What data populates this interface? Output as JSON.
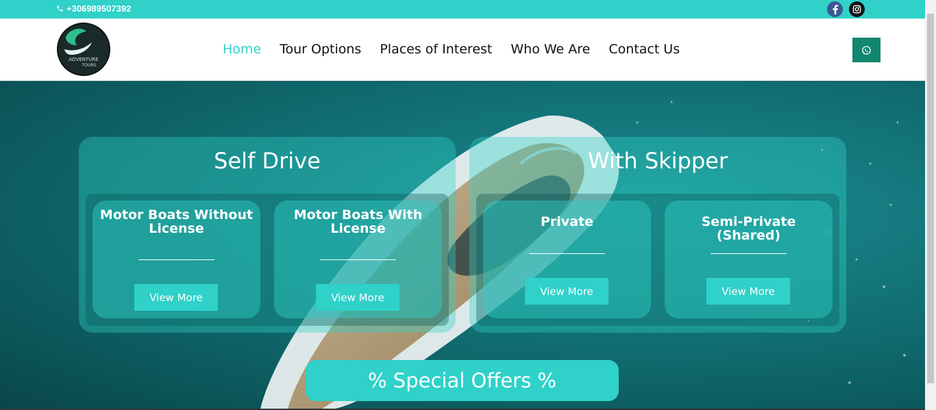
{
  "topbar": {
    "phone": "+306989507392",
    "social": [
      {
        "name": "facebook",
        "icon": "facebook-icon",
        "color": "#3b5998"
      },
      {
        "name": "instagram",
        "icon": "instagram-icon",
        "color": "#111111"
      }
    ]
  },
  "header": {
    "logo_text": "ADVENTURE TOURS",
    "nav": [
      {
        "label": "Home",
        "active": true
      },
      {
        "label": "Tour Options",
        "active": false
      },
      {
        "label": "Places of Interest",
        "active": false
      },
      {
        "label": "Who We Are",
        "active": false
      },
      {
        "label": "Contact Us",
        "active": false
      }
    ],
    "whatsapp_icon": "whatsapp-icon"
  },
  "hero": {
    "panels": [
      {
        "title": "Self Drive",
        "cards": [
          {
            "title": "Motor Boats Without License",
            "button": "View More"
          },
          {
            "title": "Motor Boats With License",
            "button": "View More"
          }
        ]
      },
      {
        "title": "With Skipper",
        "cards": [
          {
            "title": "Private",
            "button": "View More"
          },
          {
            "title": "Semi-Private (Shared)",
            "button": "View More"
          }
        ]
      }
    ],
    "offers_button": "% Special Offers %"
  },
  "colors": {
    "accent": "#2fd1c9",
    "whatsapp": "#12876f",
    "sea": "#127277"
  }
}
